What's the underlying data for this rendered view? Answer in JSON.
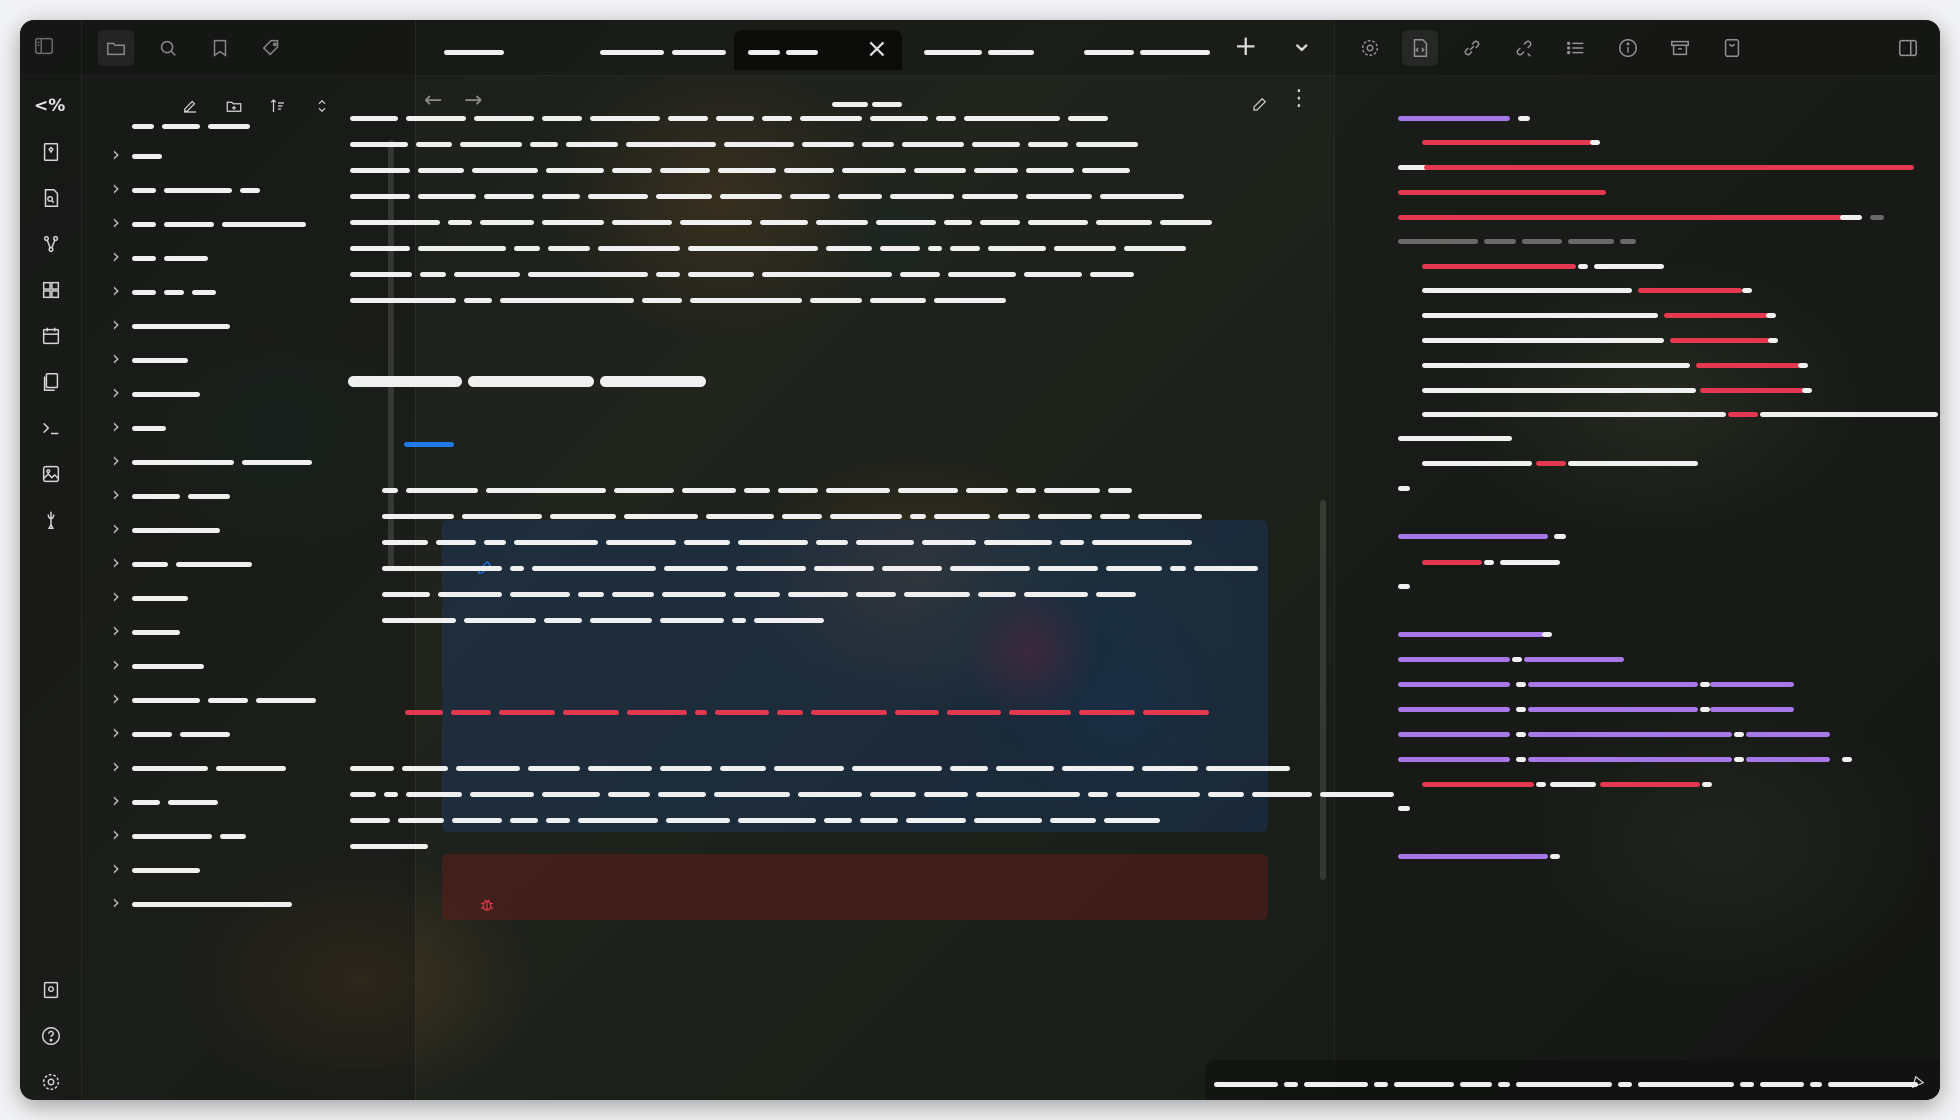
{
  "colors": {
    "accent_blue": "#1f7be8",
    "accent_red": "#e3384d",
    "accent_purple": "#a877e8",
    "text_light": "#f0f0f0"
  },
  "ribbon": {
    "top_label": "<%",
    "icons": [
      "sidebar-toggle-icon",
      "bookmark-plugin-icon",
      "file-search-icon",
      "graph-icon",
      "grid-icon",
      "calendar-icon",
      "pages-icon",
      "terminal-icon",
      "image-icon",
      "pen-icon",
      "vault-icon",
      "help-icon",
      "settings-icon"
    ]
  },
  "topbar": {
    "left_icons": [
      "folder-icon",
      "search-icon",
      "bookmark-icon",
      "tag-icon"
    ],
    "tab_close": "×",
    "tab_new": "+",
    "tab_menu": "⌄",
    "right_icons": [
      "settings-icon",
      "code-file-icon",
      "link-icon",
      "unlink-icon",
      "list-icon",
      "info-icon",
      "archive-icon",
      "book-icon",
      "sidebar-right-icon"
    ]
  },
  "left_panel": {
    "toolbar_icons": [
      "new-note-icon",
      "new-folder-icon",
      "sort-icon",
      "collapse-icon"
    ]
  },
  "editor": {
    "nav_back": "←",
    "nav_forward": "→",
    "more": "⋮"
  }
}
